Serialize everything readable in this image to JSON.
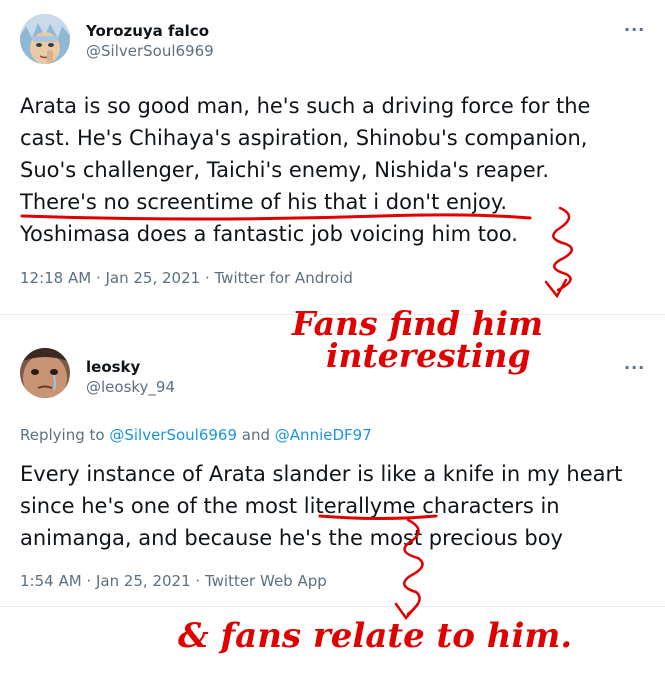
{
  "tweets": [
    {
      "name": "Yorozuya falco",
      "handle": "@SilverSoul6969",
      "lines": [
        "Arata is so good man, he's such a driving force for the",
        "cast. He's Chihaya's aspiration, Shinobu's companion,",
        "Suo's challenger, Taichi's enemy, Nishida's reaper.",
        "There's no screentime of his that i don't enjoy.",
        "Yoshimasa does a fantastic job voicing him too."
      ],
      "meta": "12:18 AM · Jan 25, 2021 · Twitter for Android"
    },
    {
      "name": "leosky",
      "handle": "@leosky_94",
      "reply_prefix": "Replying to ",
      "reply_user1": "@SilverSoul6969",
      "reply_and": " and ",
      "reply_user2": "@AnnieDF97",
      "lines": [
        "Every instance of Arata slander is like a knife in my heart",
        "since he's one of the most literallyme characters in",
        "animanga, and because he's the most precious boy"
      ],
      "meta": "1:54 AM · Jan 25, 2021 · Twitter Web App"
    }
  ],
  "more_icon": "more-horizontal-icon",
  "annotations": {
    "line1": "Fans find him",
    "line2": "interesting",
    "line3": "& fans relate to him."
  },
  "colors": {
    "annotation": "#e10000",
    "link": "#1b95e0",
    "secondary_text": "#5b7083"
  }
}
